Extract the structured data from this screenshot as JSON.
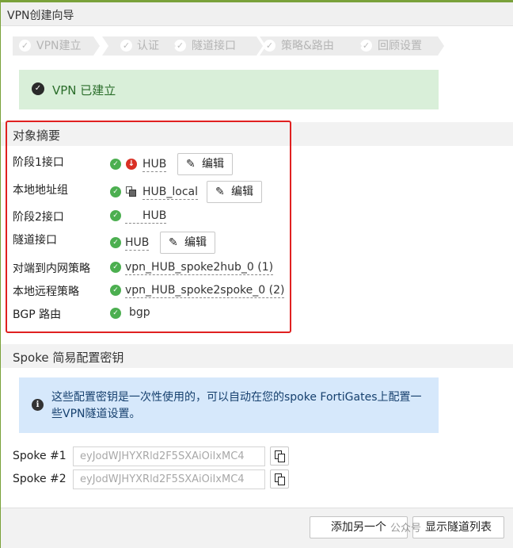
{
  "window": {
    "title": "VPN创建向导"
  },
  "steps": [
    {
      "label": "VPN建立"
    },
    {
      "label": "认证"
    },
    {
      "label": "隧道接口"
    },
    {
      "label": "策略&路由"
    },
    {
      "label": "回顾设置"
    }
  ],
  "success": {
    "message": "VPN 已建立"
  },
  "summary": {
    "heading": "对象摘要",
    "rows": [
      {
        "label": "阶段1接口",
        "value": "HUB",
        "button": "编辑"
      },
      {
        "label": "本地地址组",
        "value": "HUB_local",
        "button": "编辑"
      },
      {
        "label": "阶段2接口",
        "value": "HUB"
      },
      {
        "label": "隧道接口",
        "value": "HUB",
        "button": "编辑"
      },
      {
        "label": "对端到内网策略",
        "value": "vpn_HUB_spoke2hub_0 (1)"
      },
      {
        "label": "本地远程策略",
        "value": "vpn_HUB_spoke2spoke_0 (2)"
      },
      {
        "label": "BGP 路由",
        "value": "bgp"
      }
    ]
  },
  "spoke": {
    "heading": "Spoke 简易配置密钥",
    "info": "这些配置密钥是一次性使用的，可以自动在您的spoke FortiGates上配置一些VPN隧道设置。",
    "keys": [
      {
        "label": "Spoke #1",
        "value": "eyJodWJHYXRld2F5SXAiOiIxMC4"
      },
      {
        "label": "Spoke #2",
        "value": "eyJodWJHYXRld2F5SXAiOiIxMC4"
      }
    ]
  },
  "footer": {
    "add_another": "添加另一个",
    "show_tunnels": "显示隧道列表",
    "watermark": "公众号"
  }
}
